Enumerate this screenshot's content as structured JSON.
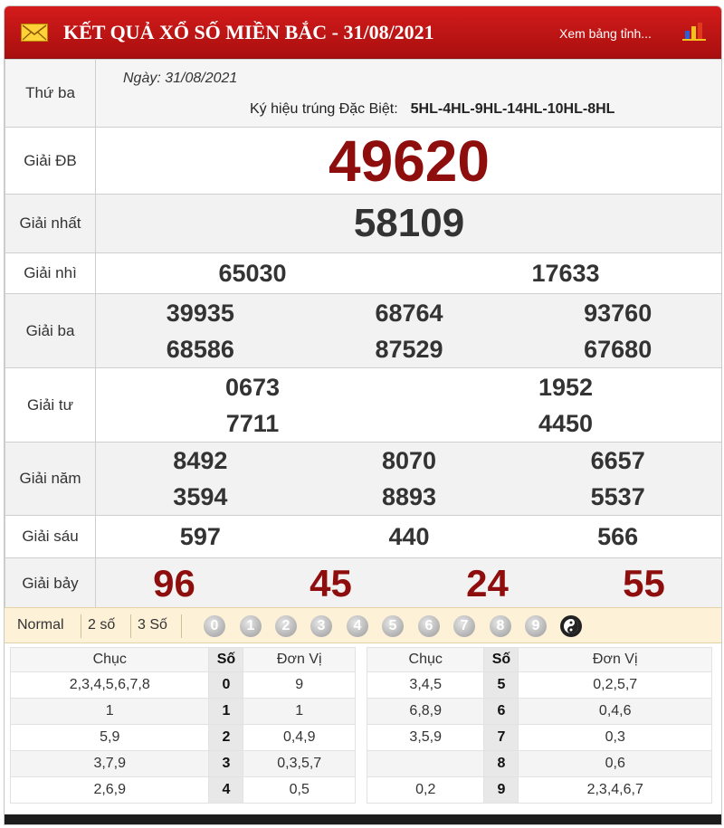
{
  "header": {
    "title": "KẾT QUẢ XỔ SỐ MIỀN BẮC - 31/08/2021",
    "link": "Xem bảng tỉnh...",
    "mail_icon": "envelope-icon",
    "chart_icon": "bar-chart-icon",
    "colors": {
      "bar": "#c41515",
      "special": "#8e0d0d",
      "toolbar": "#fdf1d8"
    }
  },
  "info": {
    "day": "Thứ ba",
    "date": "Ngày: 31/08/2021",
    "kyhieu_label": "Ký hiệu trúng Đặc Biệt:",
    "kyhieu_value": "5HL-4HL-9HL-14HL-10HL-8HL"
  },
  "prizes": {
    "db": {
      "label": "Giải ĐB",
      "numbers": [
        "49620"
      ]
    },
    "g1": {
      "label": "Giải nhất",
      "numbers": [
        "58109"
      ]
    },
    "g2": {
      "label": "Giải nhì",
      "numbers": [
        "65030",
        "17633"
      ]
    },
    "g3": {
      "label": "Giải ba",
      "numbers": [
        "39935",
        "68764",
        "93760",
        "68586",
        "87529",
        "67680"
      ]
    },
    "g4": {
      "label": "Giải tư",
      "numbers": [
        "0673",
        "1952",
        "7711",
        "4450"
      ]
    },
    "g5": {
      "label": "Giải năm",
      "numbers": [
        "8492",
        "8070",
        "6657",
        "3594",
        "8893",
        "5537"
      ]
    },
    "g6": {
      "label": "Giải sáu",
      "numbers": [
        "597",
        "440",
        "566"
      ]
    },
    "g7": {
      "label": "Giải bảy",
      "numbers": [
        "96",
        "45",
        "24",
        "55"
      ]
    }
  },
  "toolbar": {
    "modes": [
      "Normal",
      "2 số",
      "3 Số"
    ],
    "digits": [
      "0",
      "1",
      "2",
      "3",
      "4",
      "5",
      "6",
      "7",
      "8",
      "9"
    ],
    "last_icon": "yin-yang-icon"
  },
  "loto": {
    "headers": {
      "chuc": "Chục",
      "so": "Số",
      "donvi": "Đơn Vị"
    },
    "left": [
      {
        "chuc": "2,3,4,5,6,7,8",
        "so": "0",
        "donvi": "9"
      },
      {
        "chuc": "1",
        "so": "1",
        "donvi": "1"
      },
      {
        "chuc": "5,9",
        "so": "2",
        "donvi": "0,4,9"
      },
      {
        "chuc": "3,7,9",
        "so": "3",
        "donvi": "0,3,5,7"
      },
      {
        "chuc": "2,6,9",
        "so": "4",
        "donvi": "0,5"
      }
    ],
    "right": [
      {
        "chuc": "3,4,5",
        "so": "5",
        "donvi": "0,2,5,7"
      },
      {
        "chuc": "6,8,9",
        "so": "6",
        "donvi": "0,4,6"
      },
      {
        "chuc": "3,5,9",
        "so": "7",
        "donvi": "0,3"
      },
      {
        "chuc": "",
        "so": "8",
        "donvi": "0,6"
      },
      {
        "chuc": "0,2",
        "so": "9",
        "donvi": "2,3,4,6,7"
      }
    ]
  }
}
